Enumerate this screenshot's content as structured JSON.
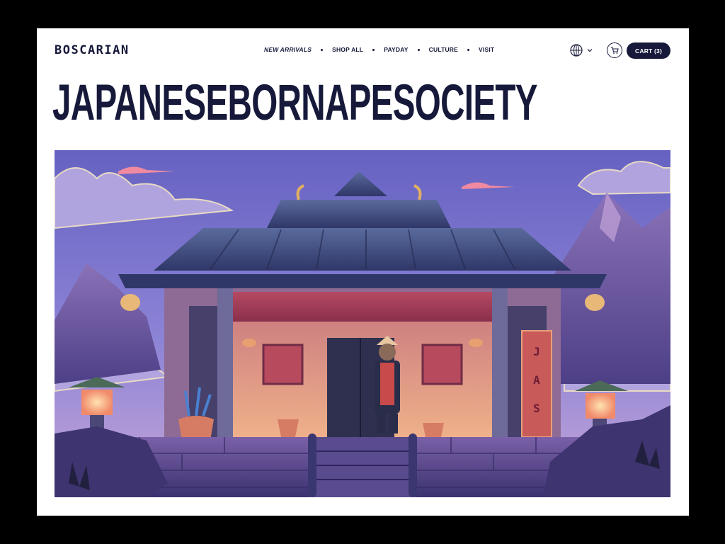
{
  "brand": {
    "logo": "BOSCARIAN"
  },
  "nav": {
    "items": [
      "NEW ARRIVALS",
      "SHOP ALL",
      "PAYDAY",
      "CULTURE",
      "VISIT"
    ]
  },
  "header": {
    "cart_label": "CART (3)",
    "language_icon": "globe-icon",
    "cart_icon": "cart-icon"
  },
  "hero": {
    "headline": "JAPANESEBORNAPESOCIETY",
    "banner_text": [
      "J",
      "A",
      "S"
    ]
  },
  "colors": {
    "navy": "#16193a",
    "sky": "#6f6bc4",
    "roof": "#3b4778",
    "wall": "#d98880"
  }
}
